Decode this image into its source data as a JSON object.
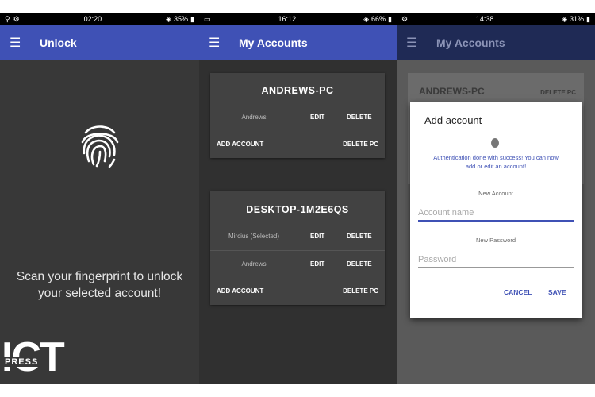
{
  "screens": [
    {
      "status": {
        "time": "02:20",
        "battery": "35%"
      },
      "app_title": "Unlock",
      "message_line1": "Scan your fingerprint to unlock",
      "message_line2": "your selected account!"
    },
    {
      "status": {
        "time": "16:12",
        "battery": "66%"
      },
      "app_title": "My Accounts",
      "cards": [
        {
          "title": "ANDREWS-PC",
          "accounts": [
            {
              "name": "Andrews",
              "edit": "EDIT",
              "delete": "DELETE"
            }
          ],
          "add_account": "ADD ACCOUNT",
          "delete_pc": "DELETE PC"
        },
        {
          "title": "DESKTOP-1M2E6QS",
          "accounts": [
            {
              "name": "Mircius (Selected)",
              "edit": "EDIT",
              "delete": "DELETE"
            },
            {
              "name": "Andrews",
              "edit": "EDIT",
              "delete": "DELETE"
            }
          ],
          "add_account": "ADD ACCOUNT",
          "delete_pc": "DELETE PC"
        }
      ]
    },
    {
      "status": {
        "time": "14:38",
        "battery": "31%"
      },
      "app_title": "My Accounts",
      "background_card": {
        "title": "ANDREWS-PC",
        "delete": "DELETE PC"
      },
      "dialog": {
        "title": "Add account",
        "auth_message_line1": "Authentication done with success! You can now",
        "auth_message_line2": "add or edit an account!",
        "new_account_label": "New Account",
        "account_name_placeholder": "Account name",
        "new_password_label": "New Password",
        "password_placeholder": "Password",
        "cancel": "CANCEL",
        "save": "SAVE"
      }
    }
  ],
  "logo": {
    "ict": "ICT",
    "press": "PRESS"
  },
  "colors": {
    "accent": "#3f51b5",
    "panel_bg": "#383838",
    "card_bg": "#424242"
  }
}
